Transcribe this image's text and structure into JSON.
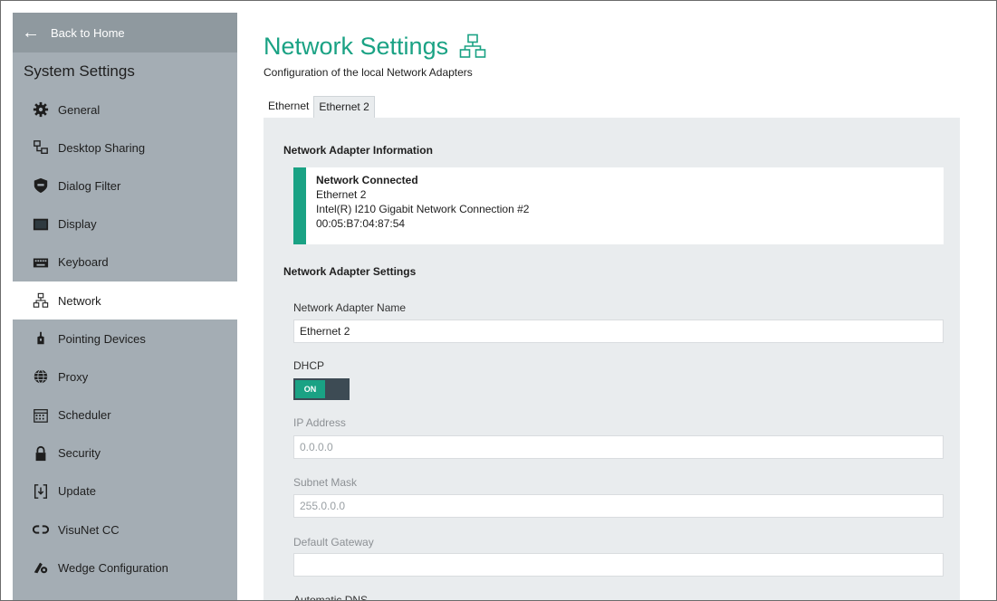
{
  "sidebar": {
    "back_label": "Back to Home",
    "title": "System Settings",
    "items": [
      {
        "label": "General",
        "icon": "gear-icon"
      },
      {
        "label": "Desktop Sharing",
        "icon": "desktop-sharing-icon"
      },
      {
        "label": "Dialog Filter",
        "icon": "shield-icon"
      },
      {
        "label": "Display",
        "icon": "display-icon"
      },
      {
        "label": "Keyboard",
        "icon": "keyboard-icon"
      },
      {
        "label": "Network",
        "icon": "network-icon"
      },
      {
        "label": "Pointing Devices",
        "icon": "pointer-icon"
      },
      {
        "label": "Proxy",
        "icon": "globe-icon"
      },
      {
        "label": "Scheduler",
        "icon": "calendar-icon"
      },
      {
        "label": "Security",
        "icon": "lock-icon"
      },
      {
        "label": "Update",
        "icon": "update-icon"
      },
      {
        "label": "VisuNet CC",
        "icon": "link-icon"
      },
      {
        "label": "Wedge Configuration",
        "icon": "wedge-icon"
      }
    ],
    "active_index": 5
  },
  "header": {
    "title": "Network Settings",
    "subtitle": "Configuration of the local Network Adapters"
  },
  "tabs": [
    {
      "label": "Ethernet"
    },
    {
      "label": "Ethernet 2"
    }
  ],
  "adapter_info": {
    "heading": "Network Adapter Information",
    "status": "Network Connected",
    "name": "Ethernet 2",
    "device": "Intel(R) I210 Gigabit Network Connection #2",
    "mac": "00:05:B7:04:87:54"
  },
  "adapter_settings": {
    "heading": "Network Adapter Settings",
    "name_label": "Network Adapter Name",
    "name_value": "Ethernet 2",
    "dhcp_label": "DHCP",
    "dhcp_state": "ON",
    "ip_label": "IP Address",
    "ip_value": "0.0.0.0",
    "subnet_label": "Subnet Mask",
    "subnet_value": "255.0.0.0",
    "gateway_label": "Default Gateway",
    "gateway_value": "",
    "dns_label": "Automatic DNS"
  },
  "colors": {
    "accent": "#1aa284",
    "sidebar_bg": "#a4adb4",
    "panel_bg": "#e9ecee"
  }
}
